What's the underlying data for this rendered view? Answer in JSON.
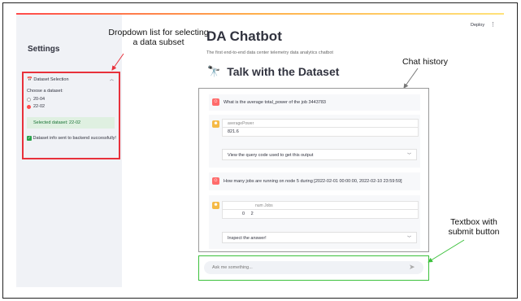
{
  "sidebar": {
    "settings_title": "Settings",
    "dataset_header": "Dataset Selection",
    "choose_label": "Choose a dataset:",
    "options": [
      {
        "label": "20-04",
        "selected": false
      },
      {
        "label": "22-02",
        "selected": true
      }
    ],
    "selected_text": "Selected dataset: 22-02",
    "info_text": "Dataset info sent to backend successfully!"
  },
  "header": {
    "deploy": "Deploy",
    "menu": "⋮"
  },
  "main": {
    "title": "DA Chatbot",
    "subtitle": "The first end-to-end data center telemetry data analytics chatbot",
    "section_title": "Talk with the Dataset"
  },
  "chat": {
    "q1": "What is the average total_power of the job 3443783",
    "a1_column": "averagePower",
    "a1_value": "821.6",
    "a1_expander": "View the query code used to get this output",
    "q2": "How many jobs are running on node 5 during [2022-02-01 00:00:00, 2022-02-10 23:59:59]",
    "a2_column": "num Jobs",
    "a2_index": "0",
    "a2_value": "2",
    "a2_expander": "Inspect the answer!"
  },
  "input": {
    "placeholder": "Ask me something..."
  },
  "annotations": {
    "dropdown": "Dropdown list for selecting a data subset",
    "history": "Chat history",
    "textbox": "Textbox with submit button"
  },
  "colors": {
    "accent": "#ff4b4b",
    "red_box": "#e8313b",
    "green_box": "#3cc13c",
    "sidebar_bg": "#f0f2f6"
  }
}
